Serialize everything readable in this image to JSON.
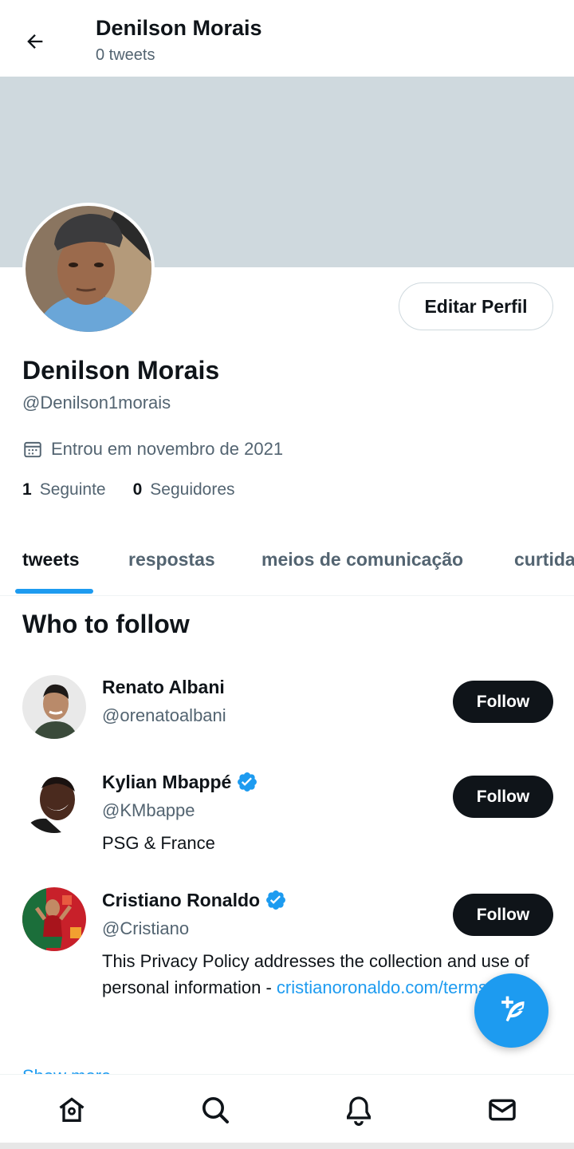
{
  "header": {
    "name": "Denilson Morais",
    "tweet_count": "0 tweets",
    "back_icon": "arrow-left-icon"
  },
  "profile": {
    "name": "Denilson Morais",
    "handle": "@Denilson1morais",
    "joined": "Entrou em novembro de 2021",
    "following_count": "1",
    "following_label": "Seguinte",
    "followers_count": "0",
    "followers_label": "Seguidores",
    "edit_label": "Editar Perfil",
    "banner_color": "#cfd9de"
  },
  "tabs": [
    {
      "label": "tweets",
      "active": true
    },
    {
      "label": "respostas"
    },
    {
      "label": "meios de comunicação"
    },
    {
      "label": "curtidas"
    }
  ],
  "who_to_follow": {
    "title": "Who to follow",
    "items": [
      {
        "name": "Renato Albani",
        "handle": "@orenatoalbani",
        "verified": false,
        "button": "Follow"
      },
      {
        "name": "Kylian Mbappé",
        "handle": "@KMbappe",
        "verified": true,
        "bio": "PSG & France",
        "button": "Follow"
      },
      {
        "name": "Cristiano Ronaldo",
        "handle": "@Cristiano",
        "verified": true,
        "bio": "This Privacy Policy addresses the collection and use of personal information - ",
        "bio_link": "cristianoronaldo.com/terms",
        "button": "Follow"
      }
    ],
    "show_more": "Show more"
  },
  "fab_icon": "compose-tweet-icon",
  "bottom_nav": [
    "home-icon",
    "search-icon",
    "notifications-bell-icon",
    "messages-envelope-icon"
  ],
  "colors": {
    "accent": "#1d9bf0",
    "text": "#0f1419",
    "secondary": "#536471",
    "button_dark": "#0f1419"
  }
}
